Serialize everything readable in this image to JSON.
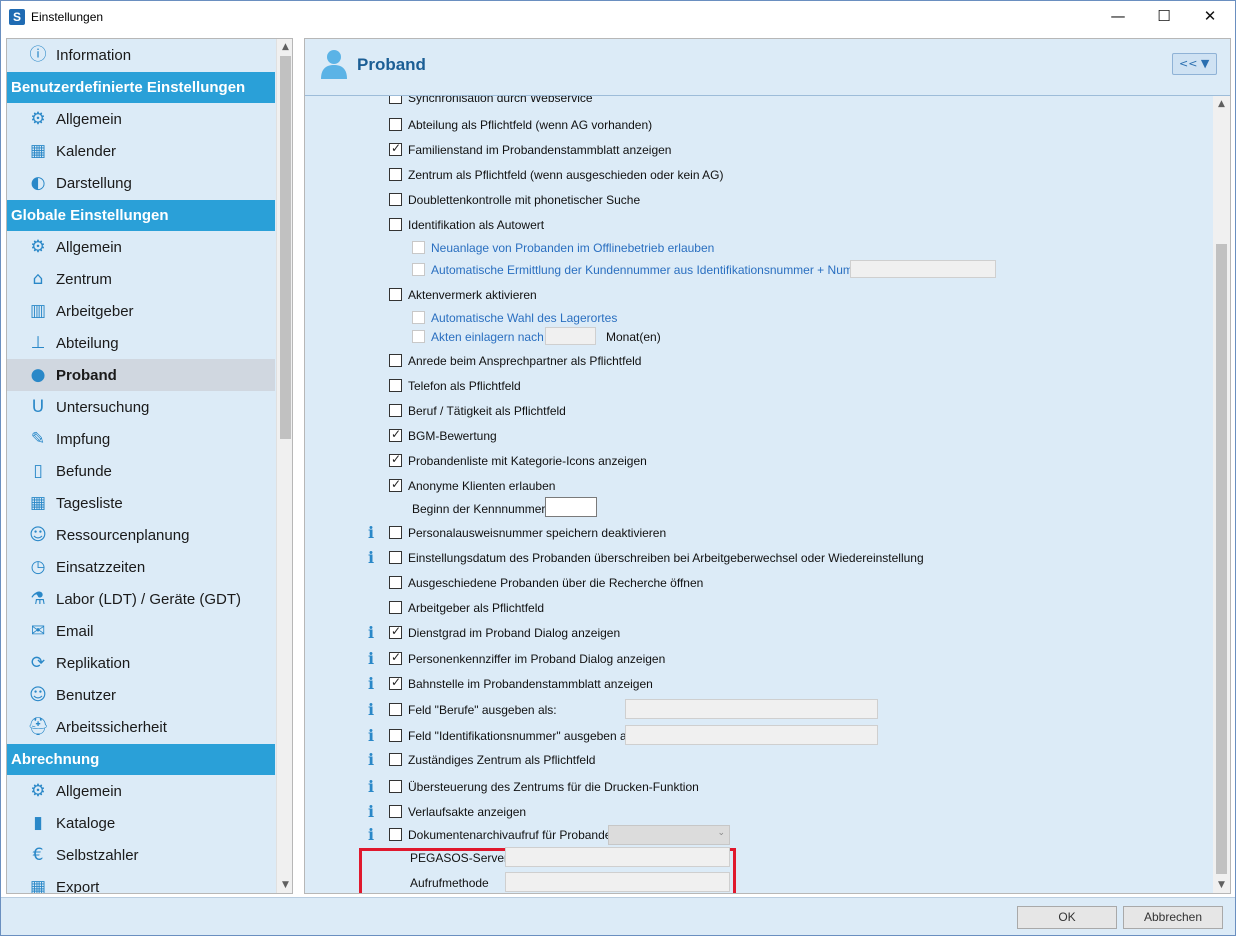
{
  "window": {
    "title": "Einstellungen",
    "app_icon": "S",
    "minimize": "—",
    "maximize": "☐",
    "close": "✕"
  },
  "sidebar": {
    "rows": [
      {
        "kind": "item",
        "label": "Information",
        "icon": "info-icon",
        "glyph": "ⓘ"
      },
      {
        "kind": "header",
        "label": "Benutzerdefinierte Einstellungen"
      },
      {
        "kind": "item",
        "label": "Allgemein",
        "icon": "gears-icon",
        "glyph": "⚙"
      },
      {
        "kind": "item",
        "label": "Kalender",
        "icon": "calendar-icon",
        "glyph": "▦"
      },
      {
        "kind": "item",
        "label": "Darstellung",
        "icon": "display-icon",
        "glyph": "◐"
      },
      {
        "kind": "header",
        "label": "Globale Einstellungen"
      },
      {
        "kind": "item",
        "label": "Allgemein",
        "icon": "gears-icon",
        "glyph": "⚙"
      },
      {
        "kind": "item",
        "label": "Zentrum",
        "icon": "building-icon",
        "glyph": "⌂"
      },
      {
        "kind": "item",
        "label": "Arbeitgeber",
        "icon": "office-icon",
        "glyph": "▥"
      },
      {
        "kind": "item",
        "label": "Abteilung",
        "icon": "hierarchy-icon",
        "glyph": "⊥"
      },
      {
        "kind": "item",
        "label": "Proband",
        "icon": "person-icon",
        "glyph": "●",
        "selected": true
      },
      {
        "kind": "item",
        "label": "Untersuchung",
        "icon": "examination-icon",
        "glyph": "U"
      },
      {
        "kind": "item",
        "label": "Impfung",
        "icon": "syringe-icon",
        "glyph": "✎"
      },
      {
        "kind": "item",
        "label": "Befunde",
        "icon": "folder-icon",
        "glyph": "▯"
      },
      {
        "kind": "item",
        "label": "Tagesliste",
        "icon": "list-icon",
        "glyph": "▦"
      },
      {
        "kind": "item",
        "label": "Ressourcenplanung",
        "icon": "people-icon",
        "glyph": "☺"
      },
      {
        "kind": "item",
        "label": "Einsatzzeiten",
        "icon": "clock-calendar-icon",
        "glyph": "◷"
      },
      {
        "kind": "item",
        "label": "Labor (LDT) / Geräte (GDT)",
        "icon": "flask-icon",
        "glyph": "⚗"
      },
      {
        "kind": "item",
        "label": "Email",
        "icon": "mail-icon",
        "glyph": "✉"
      },
      {
        "kind": "item",
        "label": "Replikation",
        "icon": "replication-icon",
        "glyph": "⟳"
      },
      {
        "kind": "item",
        "label": "Benutzer",
        "icon": "users-icon",
        "glyph": "☺"
      },
      {
        "kind": "item",
        "label": "Arbeitssicherheit",
        "icon": "worker-icon",
        "glyph": "⛑"
      },
      {
        "kind": "header",
        "label": "Abrechnung"
      },
      {
        "kind": "item",
        "label": "Allgemein",
        "icon": "gears-icon",
        "glyph": "⚙"
      },
      {
        "kind": "item",
        "label": "Kataloge",
        "icon": "book-icon",
        "glyph": "▮"
      },
      {
        "kind": "item",
        "label": "Selbstzahler",
        "icon": "euro-icon",
        "glyph": "€"
      },
      {
        "kind": "item",
        "label": "Export",
        "icon": "export-icon",
        "glyph": "▦"
      }
    ]
  },
  "panel": {
    "title": "Proband",
    "collapse_label": "<< ▼"
  },
  "options": [
    {
      "label": "Synchronisation durch Webservice",
      "checked": false,
      "clipped": true
    },
    {
      "label": "Abteilung als Pflichtfeld (wenn AG vorhanden)",
      "checked": false
    },
    {
      "label": "Familienstand im Probandenstammblatt anzeigen",
      "checked": true
    },
    {
      "label": "Zentrum als Pflichtfeld (wenn ausgeschieden oder kein AG)",
      "checked": false
    },
    {
      "label": "Doublettenkontrolle mit phonetischer Suche",
      "checked": false
    },
    {
      "label": "Identifikation als Autowert",
      "checked": false
    },
    {
      "label": "Neuanlage von Probanden im Offlinebetrieb erlauben",
      "checked": false,
      "sub": true
    },
    {
      "label": "Automatische Ermittlung der Kundennummer aus Identifikationsnummer + Nummernkreis",
      "checked": false,
      "sub": true,
      "input": "wide-disabled"
    },
    {
      "label": "Aktenvermerk aktivieren",
      "checked": false
    },
    {
      "label": "Automatische Wahl des Lagerortes",
      "checked": false,
      "sub": true
    },
    {
      "label": "Akten einlagern nach",
      "checked": false,
      "sub": true,
      "input": "months",
      "suffix": "Monat(en)"
    },
    {
      "label": "Anrede beim Ansprechpartner als Pflichtfeld",
      "checked": false
    },
    {
      "label": "Telefon als Pflichtfeld",
      "checked": false
    },
    {
      "label": "Beruf / Tätigkeit als Pflichtfeld",
      "checked": false
    },
    {
      "label": "BGM-Bewertung",
      "checked": true
    },
    {
      "label": "Probandenliste mit Kategorie-Icons anzeigen",
      "checked": true
    },
    {
      "label": "Anonyme Klienten erlauben",
      "checked": true
    },
    {
      "label": "Beginn der Kennnummer:",
      "kind": "field",
      "input": "start"
    },
    {
      "label": "Personalausweisnummer speichern deaktivieren",
      "checked": false,
      "info": true
    },
    {
      "label": "Einstellungsdatum des Probanden überschreiben bei Arbeitgeberwechsel oder Wiedereinstellung",
      "checked": false,
      "info": true
    },
    {
      "label": "Ausgeschiedene Probanden über die Recherche öffnen",
      "checked": false
    },
    {
      "label": "Arbeitgeber als Pflichtfeld",
      "checked": false
    },
    {
      "label": "Dienstgrad im Proband Dialog anzeigen",
      "checked": true,
      "info": true
    },
    {
      "label": "Personenkennziffer im Proband Dialog anzeigen",
      "checked": true,
      "info": true
    },
    {
      "label": "Bahnstelle im Probandenstammblatt anzeigen",
      "checked": true,
      "info": true
    },
    {
      "label": "Feld \"Berufe\" ausgeben als:",
      "checked": false,
      "info": true,
      "input": "text"
    },
    {
      "label": "Feld \"Identifikationsnummer\" ausgeben als:",
      "checked": false,
      "info": true,
      "input": "text"
    },
    {
      "label": "Zuständiges Zentrum als Pflichtfeld",
      "checked": false,
      "info": true
    },
    {
      "label": "Übersteuerung des Zentrums für die Drucken-Funktion",
      "checked": false,
      "info": true
    },
    {
      "label": "Verlaufsakte anzeigen",
      "checked": false,
      "info": true
    },
    {
      "label": "Dokumentenarchivaufruf für Probanden",
      "checked": false,
      "info": true,
      "input": "combo"
    },
    {
      "label": "PEGASOS-Server",
      "kind": "field",
      "input": "server"
    },
    {
      "label": "Aufrufmethode",
      "kind": "field",
      "input": "server"
    }
  ],
  "buttons": {
    "ok": "OK",
    "cancel": "Abbrechen"
  }
}
